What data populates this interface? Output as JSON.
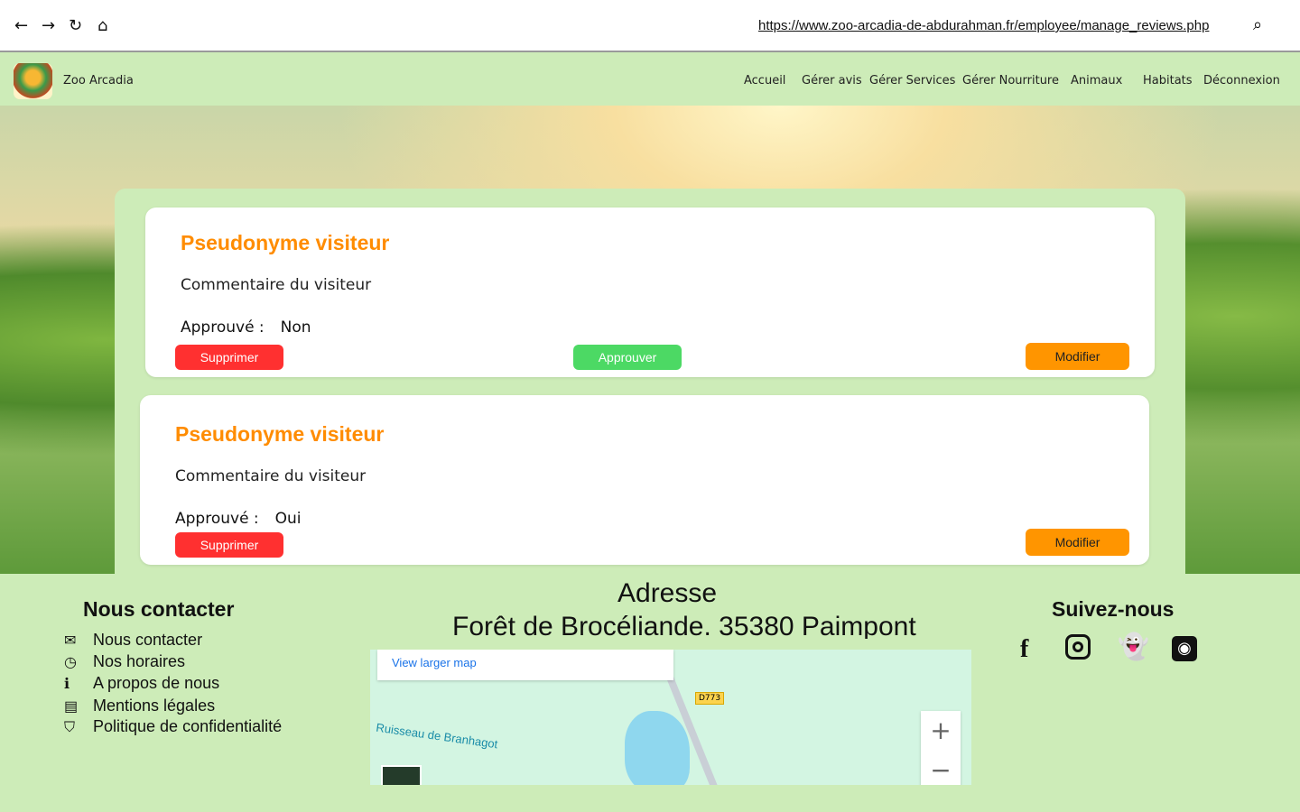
{
  "browser": {
    "url": "https://www.zoo-arcadia-de-abdurahman.fr/employee/manage_reviews.php"
  },
  "header": {
    "brand": "Zoo Arcadia",
    "menu": [
      "Accueil",
      "Gérer avis",
      "Gérer Services",
      "Gérer Nourriture",
      "Animaux",
      "Habitats",
      "Déconnexion"
    ]
  },
  "reviews": [
    {
      "pseudo": "Pseudonyme visiteur",
      "comment": "Commentaire du visiteur",
      "approved_label": "Approuvé :",
      "approved": "Non",
      "delete": "Supprimer",
      "approve": "Approuver",
      "edit": "Modifier"
    },
    {
      "pseudo": "Pseudonyme visiteur",
      "comment": "Commentaire du visiteur",
      "approved_label": "Approuvé :",
      "approved": "Oui",
      "delete": "Supprimer",
      "edit": "Modifier"
    }
  ],
  "footer": {
    "contact_title": "Nous contacter",
    "links": [
      "Nous contacter",
      "Nos horaires",
      "A propos de nous",
      "Mentions légales",
      "Politique de confidentialité"
    ],
    "address_title": "Adresse",
    "address": "Forêt de Brocéliande. 35380 Paimpont",
    "map": {
      "larger": "View larger map",
      "road": "D773",
      "river": "Ruisseau de Branhagot"
    },
    "follow_title": "Suivez-nous",
    "socials": [
      "facebook",
      "instagram",
      "snapchat",
      "github"
    ]
  },
  "colors": {
    "accent": "#ff8c00",
    "danger": "#ff3030",
    "success": "#4cd964",
    "bg": "#cdecb8"
  }
}
